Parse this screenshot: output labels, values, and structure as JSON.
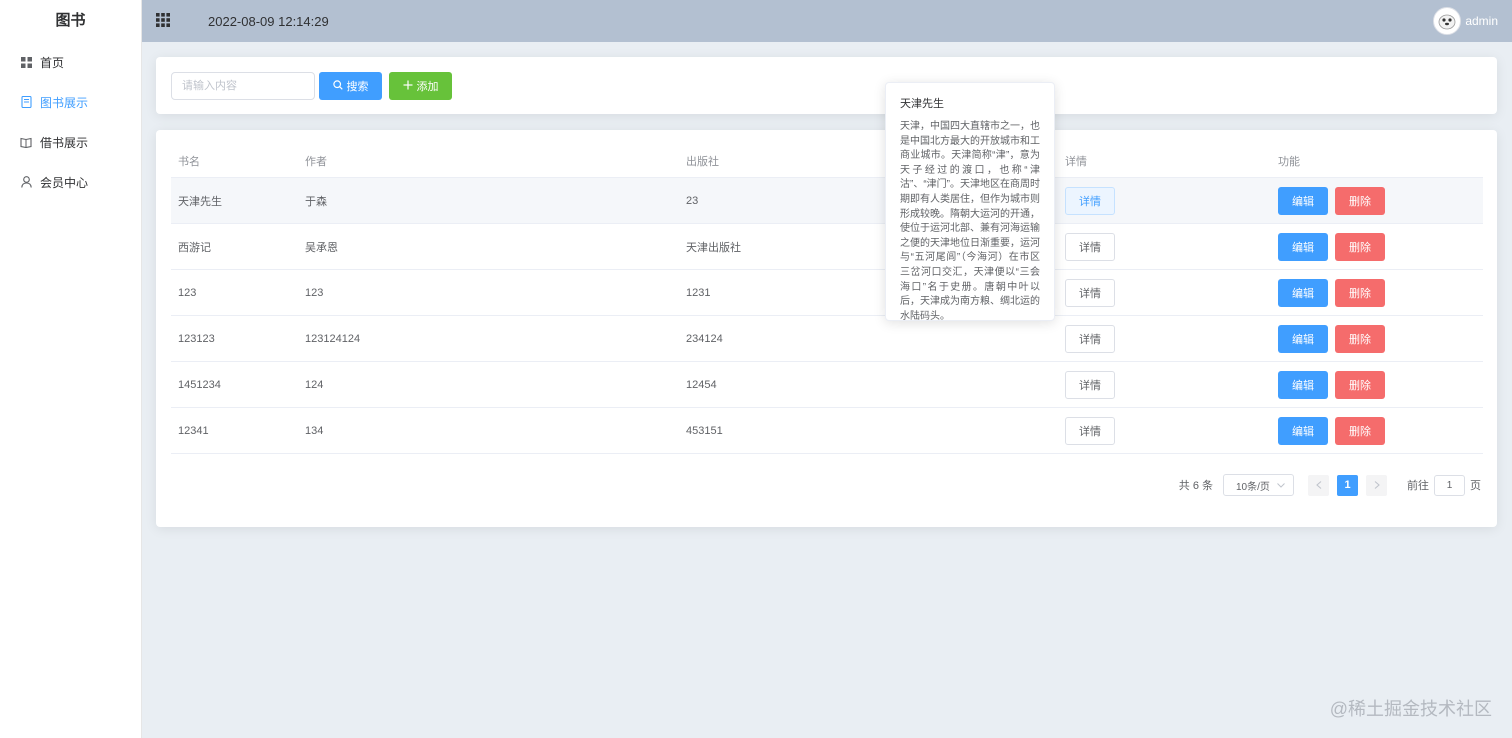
{
  "brand": "图书",
  "sidebar": {
    "items": [
      {
        "label": "首页",
        "icon": "grid-icon"
      },
      {
        "label": "图书展示",
        "icon": "book-icon",
        "active": true
      },
      {
        "label": "借书展示",
        "icon": "open-book-icon"
      },
      {
        "label": "会员中心",
        "icon": "user-icon"
      }
    ]
  },
  "header": {
    "datetime": "2022-08-09 12:14:29",
    "username": "admin"
  },
  "search": {
    "placeholder": "请输入内容",
    "search_label": "搜索",
    "add_label": "添加"
  },
  "table": {
    "columns": [
      "书名",
      "作者",
      "出版社",
      "详情",
      "功能"
    ],
    "detail_label": "详情",
    "edit_label": "编辑",
    "delete_label": "删除",
    "rows": [
      {
        "name": "天津先生",
        "author": "于森",
        "publisher": "23"
      },
      {
        "name": "西游记",
        "author": "吴承恩",
        "publisher": "天津出版社"
      },
      {
        "name": "123",
        "author": "123",
        "publisher": "1231"
      },
      {
        "name": "123123",
        "author": "123124124",
        "publisher": "234124"
      },
      {
        "name": "1451234",
        "author": "124",
        "publisher": "12454"
      },
      {
        "name": "12341",
        "author": "134",
        "publisher": "453151"
      }
    ]
  },
  "pagination": {
    "total": "共 6 条",
    "page_size": "10条/页",
    "current_page": "1",
    "goto_prefix": "前往",
    "goto_value": "1",
    "goto_suffix": "页"
  },
  "popover": {
    "title": "天津先生",
    "body": "天津，中国四大直辖市之一，也是中国北方最大的开放城市和工商业城市。天津简称“津”，意为天子经过的渡口，也称“津沽”、“津门”。天津地区在商周时期即有人类居住，但作为城市则形成较晚。隋朝大运河的开通，使位于运河北部、兼有河海运输之便的天津地位日渐重要，运河与“五河尾闾”（今海河）在市区三岔河口交汇，天津便以“三会海口”名于史册。唐朝中叶以后，天津成为南方粮、绸北运的水陆码头。"
  },
  "watermark": "@稀土掘金技术社区",
  "colors": {
    "primary": "#409eff",
    "success": "#67c23a",
    "danger": "#f56c6c",
    "header": "#b3c0d1",
    "background": "#e9eef3"
  }
}
